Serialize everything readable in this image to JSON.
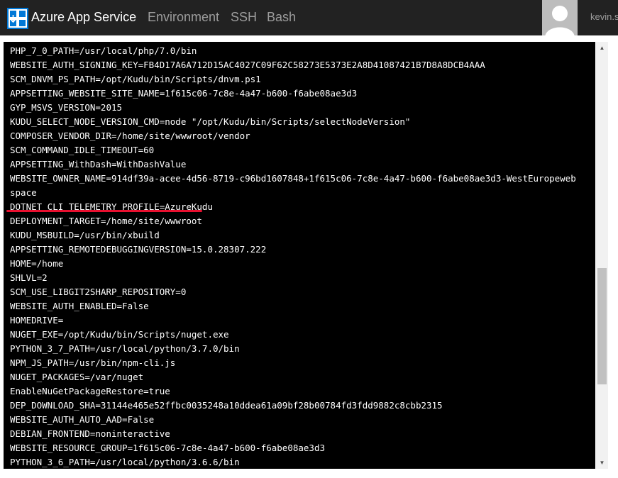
{
  "header": {
    "brand": "Azure App Service",
    "nav": [
      {
        "label": "Environment"
      },
      {
        "label": "SSH"
      },
      {
        "label": "Bash"
      }
    ],
    "user": "kevin.s"
  },
  "colors": {
    "topbar": "#222222",
    "console_bg": "#000000",
    "console_text": "#ffffff",
    "annotation_underline": "#e8102f",
    "logo_blue": "#0078d7"
  },
  "console": {
    "lines": [
      "PHP_7_0_PATH=/usr/local/php/7.0/bin",
      "WEBSITE_AUTH_SIGNING_KEY=FB4D17A6A712D15AC4027C09F62C58273E5373E2A8D41087421B7D8A8DCB4AAA",
      "SCM_DNVM_PS_PATH=/opt/Kudu/bin/Scripts/dnvm.ps1",
      "APPSETTING_WEBSITE_SITE_NAME=1f615c06-7c8e-4a47-b600-f6abe08ae3d3",
      "GYP_MSVS_VERSION=2015",
      "KUDU_SELECT_NODE_VERSION_CMD=node \"/opt/Kudu/bin/Scripts/selectNodeVersion\"",
      "COMPOSER_VENDOR_DIR=/home/site/wwwroot/vendor",
      "SCM_COMMAND_IDLE_TIMEOUT=60",
      "APPSETTING_WithDash=WithDashValue",
      "WEBSITE_OWNER_NAME=914df39a-acee-4d56-8719-c96bd1607848+1f615c06-7c8e-4a47-b600-f6abe08ae3d3-WestEuropeweb",
      "space",
      "DOTNET_CLI_TELEMETRY_PROFILE=AzureKudu",
      "DEPLOYMENT_TARGET=/home/site/wwwroot",
      "KUDU_MSBUILD=/usr/bin/xbuild",
      "APPSETTING_REMOTEDEBUGGINGVERSION=15.0.28307.222",
      "HOME=/home",
      "SHLVL=2",
      "SCM_USE_LIBGIT2SHARP_REPOSITORY=0",
      "WEBSITE_AUTH_ENABLED=False",
      "HOMEDRIVE=",
      "NUGET_EXE=/opt/Kudu/bin/Scripts/nuget.exe",
      "PYTHON_3_7_PATH=/usr/local/python/3.7.0/bin",
      "NPM_JS_PATH=/usr/bin/npm-cli.js",
      "NUGET_PACKAGES=/var/nuget",
      "EnableNuGetPackageRestore=true",
      "DEP_DOWNLOAD_SHA=31144e465e52ffbc0035248a10ddea61a09bf28b00784fd3fdd9882c8cbb2315",
      "WEBSITE_AUTH_AUTO_AAD=False",
      "DEBIAN_FRONTEND=noninteractive",
      "WEBSITE_RESOURCE_GROUP=1f615c06-7c8e-4a47-b600-f6abe08ae3d3",
      "PYTHON_3_6_PATH=/usr/local/python/3.6.6/bin"
    ]
  }
}
